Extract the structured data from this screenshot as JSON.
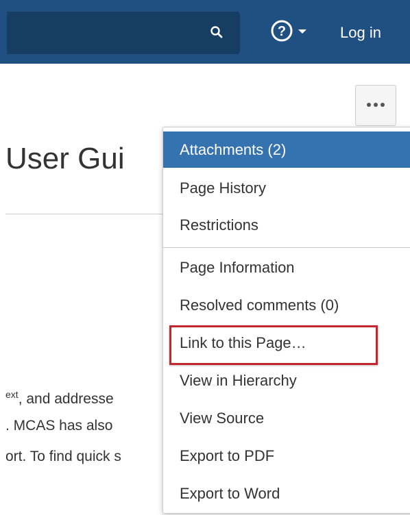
{
  "header": {
    "search_icon": "search-icon",
    "help_icon": "help-icon",
    "help_caret_icon": "caret-down-icon",
    "login_label": "Log in",
    "bar_color": "#205081"
  },
  "toolbar": {
    "more_icon": "more-actions-icon"
  },
  "page": {
    "title": "User Gui",
    "lines": [
      {
        "sup": "ext",
        "text": ", and addresse"
      },
      {
        "sup": "",
        "text": ". MCAS has also"
      },
      {
        "sup": "",
        "text": "ort. To find quick s"
      }
    ]
  },
  "menu": {
    "active_color": "#3572b0",
    "items": [
      {
        "label": "Attachments (2)",
        "active": true
      },
      {
        "label": "Page History"
      },
      {
        "label": "Restrictions"
      },
      {
        "label": "Page Information"
      },
      {
        "label": "Resolved comments (0)"
      },
      {
        "label": "Link to this Page…",
        "highlighted": true
      },
      {
        "label": "View in Hierarchy"
      },
      {
        "label": "View Source"
      },
      {
        "label": "Export to PDF"
      },
      {
        "label": "Export to Word"
      }
    ]
  },
  "annotation": {
    "highlight_color": "#c7252d"
  }
}
